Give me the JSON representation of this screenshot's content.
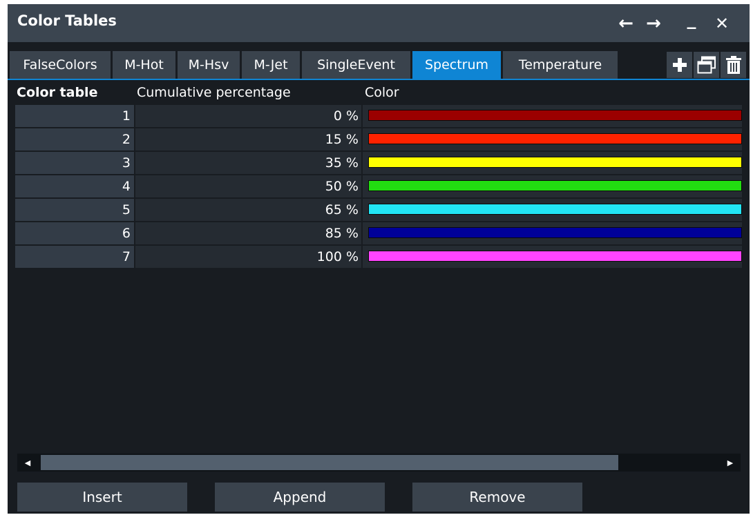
{
  "window": {
    "title": "Color Tables",
    "back_icon": "←",
    "forward_icon": "→",
    "minimize_icon": "_",
    "close_icon": "✕"
  },
  "tabs": [
    {
      "label": "FalseColors",
      "active": false
    },
    {
      "label": "M-Hot",
      "active": false
    },
    {
      "label": "M-Hsv",
      "active": false
    },
    {
      "label": "M-Jet",
      "active": false
    },
    {
      "label": "SingleEvent",
      "active": false
    },
    {
      "label": "Spectrum",
      "active": true
    },
    {
      "label": "Temperature",
      "active": false
    }
  ],
  "tab_actions": [
    {
      "icon": "plus-icon"
    },
    {
      "icon": "copy-window-icon"
    },
    {
      "icon": "trash-icon"
    }
  ],
  "table": {
    "headers": {
      "index": "Color table",
      "percentage": "Cumulative percentage",
      "color": "Color"
    },
    "rows": [
      {
        "index": "1",
        "percentage": "0 %",
        "color": "#9b0000"
      },
      {
        "index": "2",
        "percentage": "15 %",
        "color": "#ff2200"
      },
      {
        "index": "3",
        "percentage": "35 %",
        "color": "#ffff00"
      },
      {
        "index": "4",
        "percentage": "50 %",
        "color": "#22dd11"
      },
      {
        "index": "5",
        "percentage": "65 %",
        "color": "#22e5f5"
      },
      {
        "index": "6",
        "percentage": "85 %",
        "color": "#000099"
      },
      {
        "index": "7",
        "percentage": "100 %",
        "color": "#ff44ff"
      }
    ]
  },
  "scrollbar": {
    "left_arrow": "◀",
    "right_arrow": "▶"
  },
  "buttons": {
    "insert": "Insert",
    "append": "Append",
    "remove": "Remove"
  },
  "colors": {
    "accent": "#0f85d4",
    "titlebar": "#3b4550",
    "background": "#181c21"
  }
}
